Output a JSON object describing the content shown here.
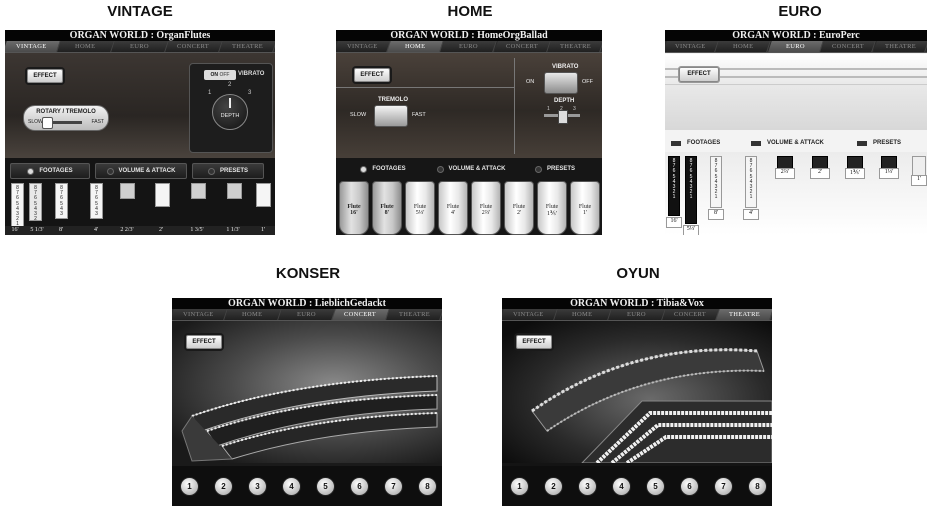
{
  "captions": [
    "VINTAGE",
    "HOME",
    "EURO",
    "KONSER",
    "OYUN"
  ],
  "tabs": [
    "VINTAGE",
    "HOME",
    "EURO",
    "CONCERT",
    "THEATRE"
  ],
  "effect_label": "EFFECT",
  "panels": {
    "vintage": {
      "title": "ORGAN WORLD : OrganFlutes",
      "active_tab": 0,
      "vibrato_label": "VIBRATO",
      "vibrato_on": "ON",
      "vibrato_off": "OFF",
      "depth_label": "DEPTH",
      "depth_marks": [
        "1",
        "2",
        "3"
      ],
      "rotary_label": "ROTARY / TREMOLO",
      "slow_label": "SLOW",
      "fast_label": "FAST",
      "nav": [
        "FOOTAGES",
        "VOLUME & ATTACK",
        "PRESETS"
      ],
      "footages": [
        "16'",
        "5 1/3'",
        "8'",
        "4'",
        "2 2/3'",
        "2'",
        "1 3/5'",
        "1 1/3'",
        "1'"
      ]
    },
    "home": {
      "title": "ORGAN WORLD : HomeOrgBallad",
      "active_tab": 1,
      "vibrato_label": "VIBRATO",
      "on_label": "ON",
      "off_label": "OFF",
      "depth_label": "DEPTH",
      "depth_marks": [
        "1",
        "2",
        "3"
      ],
      "tremolo_label": "TREMOLO",
      "slow_label": "SLOW",
      "fast_label": "FAST",
      "nav": [
        "FOOTAGES",
        "VOLUME & ATTACK",
        "PRESETS"
      ],
      "flutes": [
        {
          "name": "Flute",
          "foot": "16'"
        },
        {
          "name": "Flute",
          "foot": "8'"
        },
        {
          "name": "Flute",
          "foot": "5⅓'"
        },
        {
          "name": "Flute",
          "foot": "4'"
        },
        {
          "name": "Flute",
          "foot": "2⅔'"
        },
        {
          "name": "Flute",
          "foot": "2'"
        },
        {
          "name": "Flute",
          "foot": "1⅗'"
        },
        {
          "name": "Flute",
          "foot": "1'"
        }
      ]
    },
    "euro": {
      "title": "ORGAN WORLD : EuroPerc",
      "active_tab": 2,
      "nav": [
        "FOOTAGES",
        "VOLUME & ATTACK",
        "PRESETS"
      ],
      "footages": [
        "16'",
        "5⅓'",
        "8'",
        "4'",
        "2⅔'",
        "2'",
        "1⅗'",
        "1⅓'",
        "1'"
      ]
    },
    "konser": {
      "title": "ORGAN WORLD : LieblichGedackt",
      "active_tab": 3,
      "numbers": [
        "1",
        "2",
        "3",
        "4",
        "5",
        "6",
        "7",
        "8"
      ]
    },
    "oyun": {
      "title": "ORGAN WORLD : Tibia&Vox",
      "active_tab": 4,
      "numbers": [
        "1",
        "2",
        "3",
        "4",
        "5",
        "6",
        "7",
        "8"
      ]
    }
  }
}
